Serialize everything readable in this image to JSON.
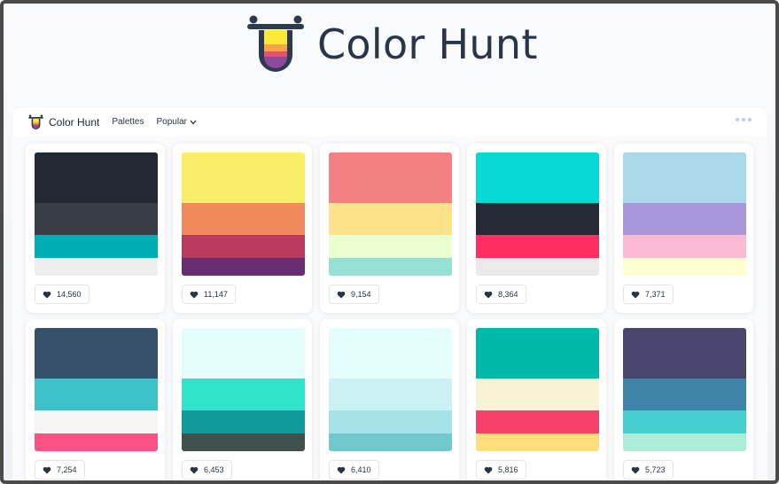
{
  "header": {
    "title": "Color Hunt"
  },
  "navbar": {
    "brand": "Color Hunt",
    "links": {
      "palettes": "Palettes",
      "popular": "Popular"
    }
  },
  "icons": {
    "like": "heart-icon",
    "menu": "more-dots-icon",
    "dropdown": "chevron-down-icon"
  },
  "palettes": [
    {
      "likes": "14,560",
      "colors": [
        "#222831",
        "#393e46",
        "#00adb5",
        "#eeeeee"
      ]
    },
    {
      "likes": "11,147",
      "colors": [
        "#f9ed69",
        "#f08a5d",
        "#b83b5e",
        "#6a2c70"
      ]
    },
    {
      "likes": "9,154",
      "colors": [
        "#f38181",
        "#fce38a",
        "#eaffd0",
        "#95e1d3"
      ]
    },
    {
      "likes": "8,364",
      "colors": [
        "#08d9d6",
        "#252a34",
        "#ff2e63",
        "#eaeaea"
      ]
    },
    {
      "likes": "7,371",
      "colors": [
        "#a8d8ea",
        "#aa96da",
        "#fcbad3",
        "#ffffd2"
      ]
    },
    {
      "likes": "7,254",
      "colors": [
        "#364f6b",
        "#3fc1c9",
        "#f5f5f5",
        "#fc5185"
      ]
    },
    {
      "likes": "6,453",
      "colors": [
        "#e3fdfd",
        "#30e3ca",
        "#11999e",
        "#40514e"
      ]
    },
    {
      "likes": "6,410",
      "colors": [
        "#e3fdfd",
        "#cbf1f5",
        "#a6e3e9",
        "#71c9ce"
      ]
    },
    {
      "likes": "5,816",
      "colors": [
        "#00b8a9",
        "#f8f3d4",
        "#f6416c",
        "#ffde7d"
      ]
    },
    {
      "likes": "5,723",
      "colors": [
        "#48466d",
        "#3d84a8",
        "#46cdcf",
        "#abedd8"
      ]
    }
  ]
}
